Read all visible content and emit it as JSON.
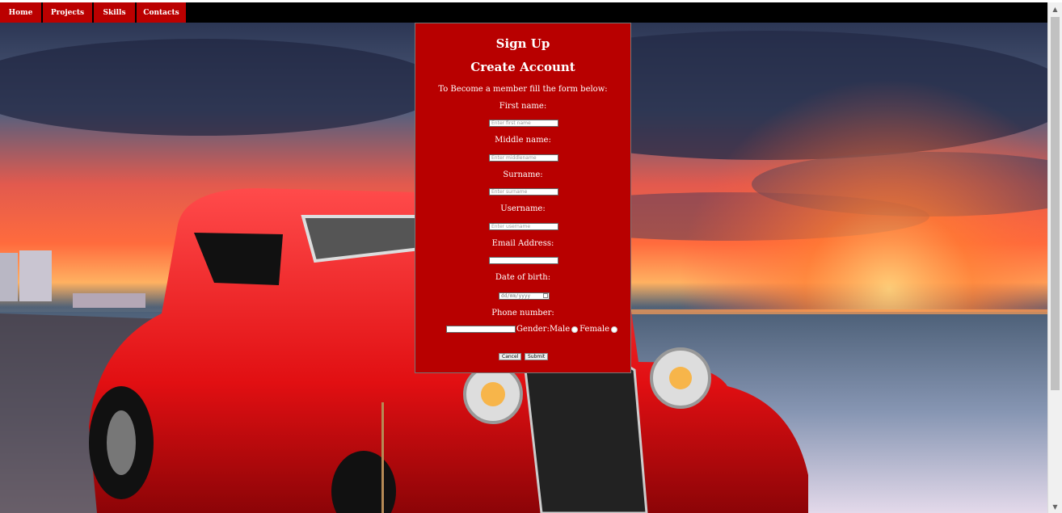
{
  "nav": {
    "items": [
      {
        "label": "Home"
      },
      {
        "label": "Projects"
      },
      {
        "label": "Skills"
      },
      {
        "label": "Contacts"
      }
    ]
  },
  "form": {
    "title": "Sign Up",
    "subtitle": "Create Account",
    "intro": "To Become a member fill the form below:",
    "first_name_label": "First name:",
    "first_name_placeholder": "Enter first name",
    "middle_name_label": "Middle name:",
    "middle_name_placeholder": "Enter middlename",
    "surname_label": "Surname:",
    "surname_placeholder": "Enter surname",
    "username_label": "Username:",
    "username_placeholder": "Enter username",
    "email_label": "Email Address:",
    "dob_label": "Date of birth:",
    "dob_value": "dd/mm/yyyy",
    "phone_label": "Phone number:",
    "gender_label": "Gender:Male",
    "female_label": "Female",
    "cancel_label": "Cancel",
    "submit_label": "Submit"
  },
  "colors": {
    "accent": "#b80000",
    "navbar": "#000000"
  }
}
